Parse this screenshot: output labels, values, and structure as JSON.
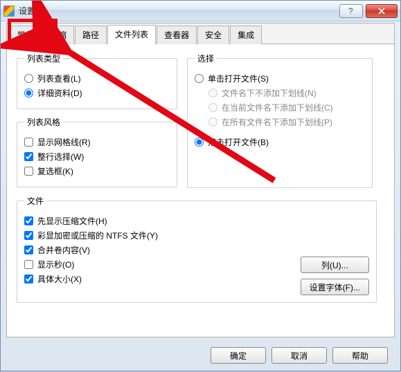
{
  "window": {
    "title": "设置"
  },
  "tabs": [
    {
      "label": "常规",
      "active": false
    },
    {
      "label": "压缩",
      "active": false
    },
    {
      "label": "路径",
      "active": false
    },
    {
      "label": "文件列表",
      "active": true
    },
    {
      "label": "查看器",
      "active": false
    },
    {
      "label": "安全",
      "active": false
    },
    {
      "label": "集成",
      "active": false
    }
  ],
  "group_list_type": {
    "legend": "列表类型",
    "opt_viewer": "列表查看(L)",
    "opt_details": "详细资料(D)"
  },
  "group_list_style": {
    "legend": "列表风格",
    "chk_grid": "显示网格线(R)",
    "chk_fullrow": "整行选择(W)",
    "chk_checkbox": "复选框(K)"
  },
  "group_select": {
    "legend": "选择",
    "opt_single": "单击打开文件(S)",
    "sub_no_underline": "文件名下不添加下划线(N)",
    "sub_cur_underline": "在当前文件名下添加下划线(C)",
    "sub_all_underline": "在所有文件名下添加下划线(P)",
    "opt_double": "双击打开文件(B)"
  },
  "group_files": {
    "legend": "文件",
    "chk_archives_first": "先显示压缩文件(H)",
    "chk_ntfs_color": "彩显加密或压缩的 NTFS 文件(Y)",
    "chk_merge_vol": "合并卷内容(V)",
    "chk_show_sec": "显示秒(O)",
    "chk_exact_size": "具体大小(X)"
  },
  "buttons": {
    "columns": "列(U)...",
    "set_font": "设置字体(F)...",
    "ok": "确定",
    "cancel": "取消",
    "help": "帮助"
  }
}
